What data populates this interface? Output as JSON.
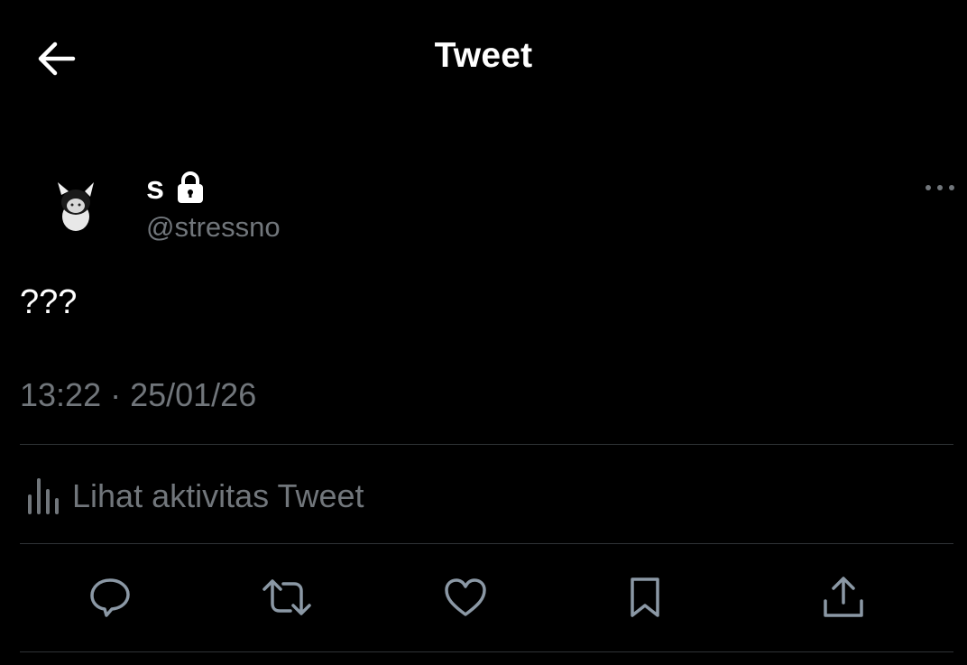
{
  "header": {
    "title": "Tweet",
    "back_icon": "arrow-left-icon"
  },
  "tweet": {
    "author": {
      "display_name": "s",
      "handle": "@stressno",
      "protected_icon": "lock-icon",
      "avatar": "cat-avatar"
    },
    "more_icon": "ellipsis-icon",
    "text": "???",
    "timestamp": "13:22 · 25/01/26",
    "activity_label": "Lihat aktivitas Tweet",
    "activity_icon": "bar-chart-icon"
  },
  "actions": [
    {
      "name": "reply",
      "icon": "reply-icon"
    },
    {
      "name": "retweet",
      "icon": "retweet-icon"
    },
    {
      "name": "like",
      "icon": "heart-icon"
    },
    {
      "name": "bookmark",
      "icon": "bookmark-icon"
    },
    {
      "name": "share",
      "icon": "share-icon"
    }
  ],
  "colors": {
    "background": "#000000",
    "primary_text": "#ffffff",
    "secondary_text": "#71767b",
    "divider": "#2f3336",
    "icon": "#8b98a5"
  }
}
